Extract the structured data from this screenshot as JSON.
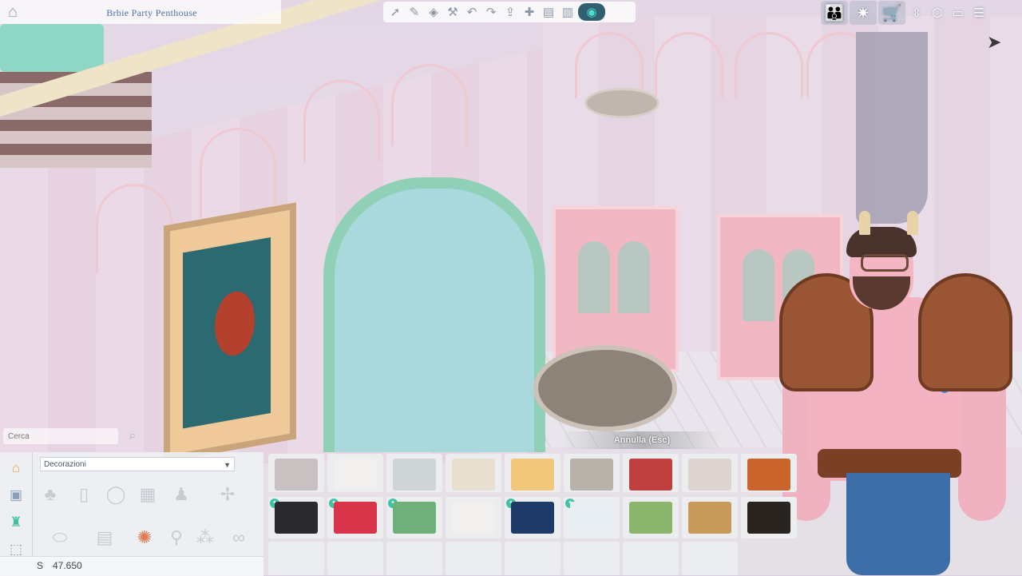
{
  "header": {
    "lot_title": "Brbie Party Penthouse"
  },
  "toolbar": {
    "tools": [
      "select-arrow-icon",
      "eyedropper-icon",
      "design-tool-icon",
      "sledgehammer-icon",
      "undo-icon",
      "redo-icon",
      "level-up-icon",
      "move-camera-icon",
      "floor-icon",
      "wall-icon",
      "view-toggle-icon"
    ]
  },
  "right_hud": {
    "buttons": [
      "household-icon",
      "tips-lightbulb-icon",
      "buy-cart-icon",
      "floor-up-down-icon",
      "build-mode-icon",
      "options-icon",
      "menu-icon"
    ]
  },
  "catalog": {
    "search_placeholder": "Cerca",
    "category": "Decorazioni",
    "side_tabs": [
      "house-tab-icon",
      "room-tab-icon",
      "style-tab-icon",
      "storage-tab-icon"
    ],
    "subcategory_icons": [
      "plant-icon",
      "wall-art-icon",
      "mirror-icon",
      "window-panel-icon",
      "sculpture-icon",
      "fan-icon",
      "rug-icon",
      "fireplace-icon",
      "animal-statue-icon",
      "candle-icon",
      "dots-icon",
      "infinity-icon"
    ]
  },
  "funds": {
    "symbol": "S",
    "value": "47.650"
  },
  "hint": {
    "cancel_label": "Annulla (Esc)"
  },
  "items": {
    "row1": [
      "#c9c0c2",
      "#f2f0ee",
      "#cfd5d4",
      "#e8dfd0",
      "#f3c77a",
      "#b8b2aa",
      "#c04040",
      "#e0d4d0",
      "#c8642c"
    ],
    "row2": [
      "#2a2a2e",
      "#d8344a",
      "#6fb07a",
      "#f1f0ee",
      "#1e3a68",
      "#e8eef2",
      "#8ab56a",
      "#c89a5a",
      "#2a2420"
    ]
  },
  "colors": {
    "accent": "#3fc3a7",
    "title": "#4c72a8"
  }
}
